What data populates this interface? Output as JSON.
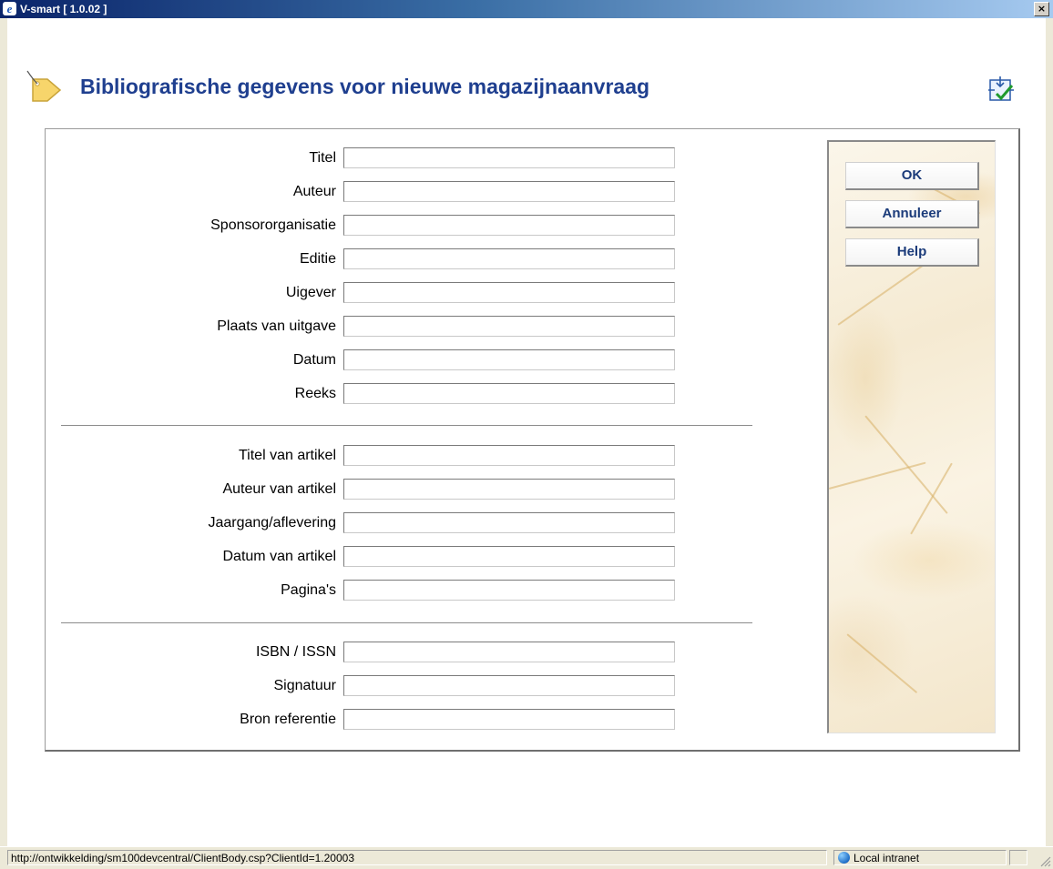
{
  "window": {
    "title": "V-smart [ 1.0.02 ]",
    "close_glyph": "×"
  },
  "header": {
    "title": "Bibliografische gegevens voor nieuwe magazijnaanvraag",
    "icon": "tag-icon",
    "corner_icon": "checklist-icon"
  },
  "form": {
    "group1": [
      {
        "label": "Titel",
        "value": ""
      },
      {
        "label": "Auteur",
        "value": ""
      },
      {
        "label": "Sponsororganisatie",
        "value": ""
      },
      {
        "label": "Editie",
        "value": ""
      },
      {
        "label": "Uigever",
        "value": ""
      },
      {
        "label": "Plaats van uitgave",
        "value": ""
      },
      {
        "label": "Datum",
        "value": ""
      },
      {
        "label": "Reeks",
        "value": ""
      }
    ],
    "group2": [
      {
        "label": "Titel van artikel",
        "value": ""
      },
      {
        "label": "Auteur van artikel",
        "value": ""
      },
      {
        "label": "Jaargang/aflevering",
        "value": ""
      },
      {
        "label": "Datum van artikel",
        "value": ""
      },
      {
        "label": "Pagina's",
        "value": ""
      }
    ],
    "group3": [
      {
        "label": "ISBN / ISSN",
        "value": ""
      },
      {
        "label": "Signatuur",
        "value": ""
      },
      {
        "label": "Bron referentie",
        "value": ""
      }
    ]
  },
  "actions": {
    "ok": "OK",
    "cancel": "Annuleer",
    "help": "Help"
  },
  "statusbar": {
    "url": "http://ontwikkelding/sm100devcentral/ClientBody.csp?ClientId=1.20003",
    "zone": "Local intranet",
    "zone_icon": "globe-icon"
  },
  "colors": {
    "title": "#1f3f8f",
    "button_text": "#1b3b7a",
    "titlebar": "#0a246a"
  }
}
